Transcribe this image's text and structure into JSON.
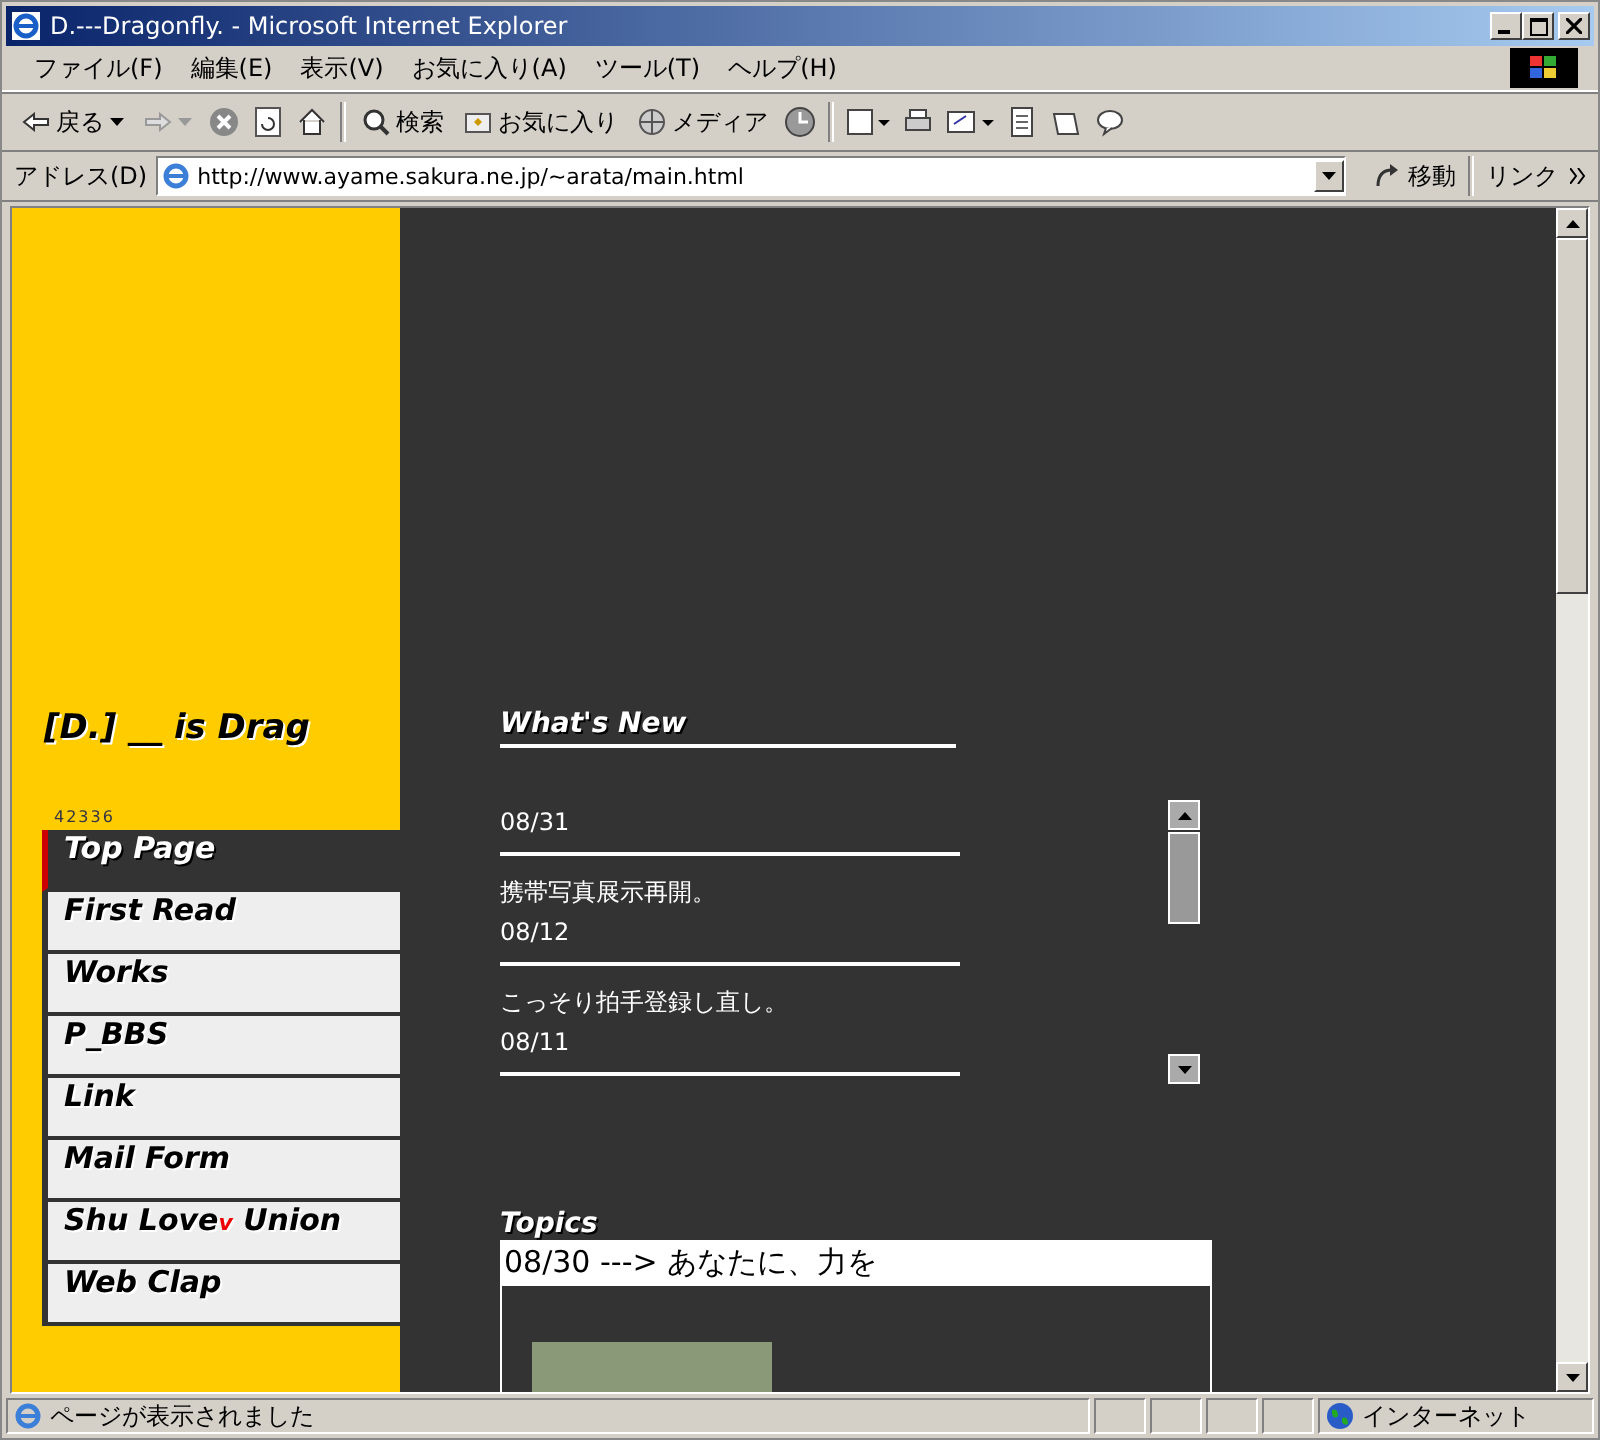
{
  "window": {
    "title": "D.---Dragonfly. - Microsoft Internet Explorer"
  },
  "menu": [
    "ファイル(F)",
    "編集(E)",
    "表示(V)",
    "お気に入り(A)",
    "ツール(T)",
    "ヘルプ(H)"
  ],
  "toolbar": {
    "back": "戻る",
    "search": "検索",
    "favorites": "お気に入り",
    "media": "メディア"
  },
  "address_bar": {
    "label": "アドレス(D)",
    "value": "http://www.ayame.sakura.ne.jp/~arata/main.html",
    "go": "移動",
    "links": "リンク"
  },
  "sidebar": {
    "site_title": "[D.] __ is Drag",
    "counter": "42336",
    "items": [
      {
        "label": "Top Page",
        "selected": true
      },
      {
        "label": "First Read",
        "selected": false
      },
      {
        "label": "Works",
        "selected": false
      },
      {
        "label": "P_BBS",
        "selected": false
      },
      {
        "label": "Link",
        "selected": false
      },
      {
        "label": "Mail Form",
        "selected": false
      },
      {
        "label": "Shu Love",
        "mark": "v",
        "suffix": "Union",
        "selected": false
      },
      {
        "label": "Web Clap",
        "selected": false
      }
    ]
  },
  "whats_new": {
    "heading": "What's New",
    "entries": [
      {
        "date": "08/31"
      },
      {
        "text": "携帯写真展示再開。",
        "date": "08/12"
      },
      {
        "text": "こっそり拍手登録し直し。",
        "date": "08/11"
      }
    ]
  },
  "topics": {
    "heading": "Topics",
    "title": "08/30 ---> あなたに、力を"
  },
  "status_bar": {
    "text": "ページが表示されました",
    "zone": "インターネット"
  }
}
